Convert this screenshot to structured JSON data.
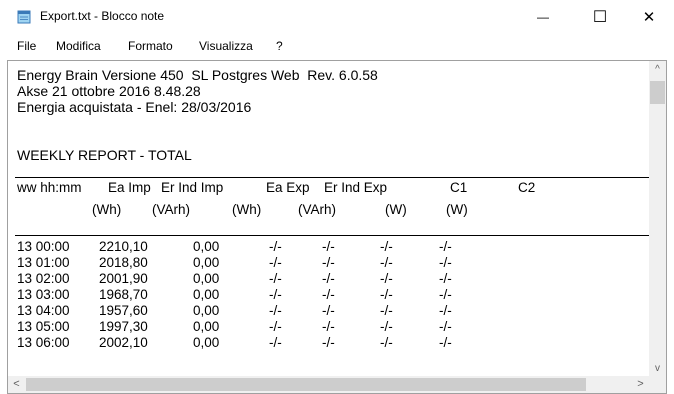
{
  "window": {
    "title": "Export.txt - Blocco note",
    "min_glyph": "—",
    "max_glyph": "☐",
    "close_glyph": "✕"
  },
  "menu": [
    "File",
    "Modifica",
    "Formato",
    "Visualizza",
    "?"
  ],
  "header_lines": [
    "Energy Brain Versione 450  SL Postgres Web  Rev. 6.0.58",
    "Akse 21 ottobre 2016 8.48.28",
    "Energia acquistata - Enel: 28/03/2016",
    "",
    "WEEKLY REPORT - TOTAL"
  ],
  "columns": [
    "ww hh:mm",
    "Ea Imp",
    "Er Ind Imp",
    "Ea Exp",
    "Er Ind Exp",
    "C1",
    "C2"
  ],
  "units": [
    "(Wh)",
    "(VArh)",
    "(Wh)",
    "(VArh)",
    "(W)",
    "(W)"
  ],
  "rows": [
    [
      "13 00:00",
      "2210,10",
      "0,00",
      "-/-",
      "-/-",
      "-/-",
      "-/-"
    ],
    [
      "13 01:00",
      "2018,80",
      "0,00",
      "-/-",
      "-/-",
      "-/-",
      "-/-"
    ],
    [
      "13 02:00",
      "2001,90",
      "0,00",
      "-/-",
      "-/-",
      "-/-",
      "-/-"
    ],
    [
      "13 03:00",
      "1968,70",
      "0,00",
      "-/-",
      "-/-",
      "-/-",
      "-/-"
    ],
    [
      "13 04:00",
      "1957,60",
      "0,00",
      "-/-",
      "-/-",
      "-/-",
      "-/-"
    ],
    [
      "13 05:00",
      "1997,30",
      "0,00",
      "-/-",
      "-/-",
      "-/-",
      "-/-"
    ],
    [
      "13 06:00",
      "2002,10",
      "0,00",
      "-/-",
      "-/-",
      "-/-",
      "-/-"
    ]
  ],
  "scroll": {
    "up": "^",
    "down": "v",
    "left": "<",
    "right": ">"
  }
}
